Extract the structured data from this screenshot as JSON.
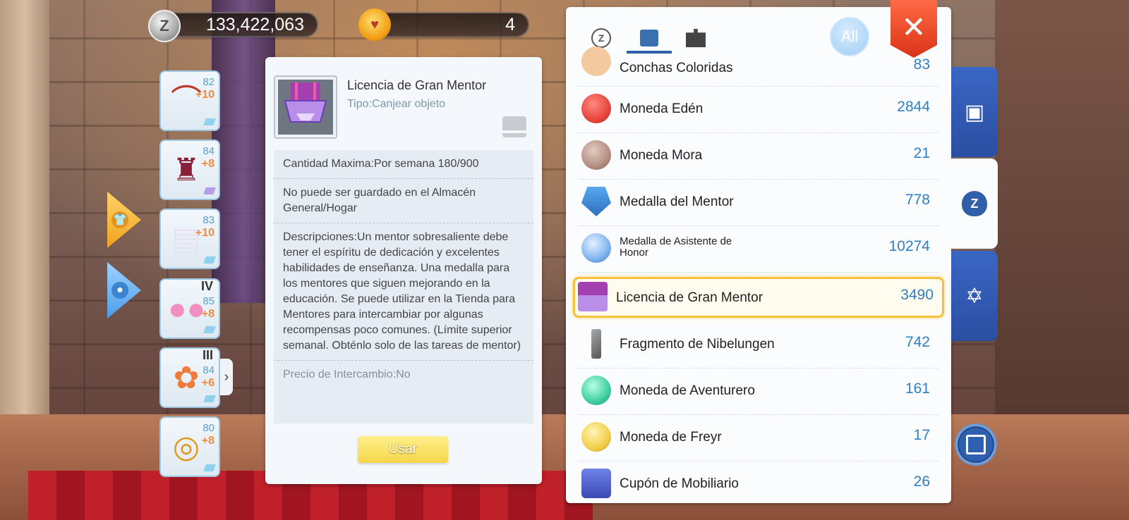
{
  "currency": {
    "zeny": "133,422,063",
    "gems": "4"
  },
  "equipment": [
    {
      "level": "82",
      "refine": "+10",
      "icon": "bracelet-icon",
      "gem": "blue"
    },
    {
      "level": "84",
      "refine": "+8",
      "icon": "armor-icon",
      "gem": "purple"
    },
    {
      "level": "83",
      "refine": "+10",
      "icon": "cloak-icon",
      "gem": "blue"
    },
    {
      "level": "85",
      "refine": "+8",
      "tier": "IV",
      "icon": "slippers-icon",
      "gem": "blue"
    },
    {
      "level": "84",
      "refine": "+6",
      "tier": "III",
      "icon": "fairy-icon",
      "gem": "blue"
    },
    {
      "level": "80",
      "refine": "+8",
      "icon": "ring-icon",
      "gem": "blue"
    }
  ],
  "detail": {
    "title": "Licencia de Gran Mentor",
    "type": "Tipo:Canjear objeto",
    "max_qty": "Cantidad Maxima:Por semana 180/900",
    "storage_note": "No puede ser guardado en el Almacén General/Hogar",
    "description": "Descripciones:Un mentor sobresaliente debe tener el espíritu de dedicación y excelentes habilidades de enseñanza. Una medalla para los mentores que siguen mejorando en la educación. Se puede utilizar en la Tienda para Mentores para intercambiar por algunas recompensas poco comunes. (Límite superior semanal. Obténlo solo de las tareas de mentor)",
    "trade_price": "Precio de Intercambio:No",
    "use_button": "Usar"
  },
  "list": {
    "all_button": "All",
    "close_glyph": "✕",
    "items": [
      {
        "name": "Conchas Coloridas",
        "count": "83",
        "color": "#f3c9a0"
      },
      {
        "name": "Moneda Edén",
        "count": "2844",
        "color": "#e8453c"
      },
      {
        "name": "Moneda Mora",
        "count": "21",
        "color": "#b68f82"
      },
      {
        "name": "Medalla del Mentor",
        "count": "778",
        "color": "#3d8fd8"
      },
      {
        "name": "Medalla de Asistente de Honor",
        "count": "10274",
        "color": "#7fb3ee"
      },
      {
        "name": "Licencia de Gran Mentor",
        "count": "3490",
        "color": "#8a4fd0"
      },
      {
        "name": "Fragmento de Nibelungen",
        "count": "742",
        "color": "#8a8a8a"
      },
      {
        "name": "Moneda de Aventurero",
        "count": "161",
        "color": "#3fcf9f"
      },
      {
        "name": "Moneda de Freyr",
        "count": "17",
        "color": "#f2cf4a"
      },
      {
        "name": "Cupón de Mobiliario",
        "count": "26",
        "color": "#4a5ec7"
      }
    ]
  },
  "colors": {
    "accent": "#2f7fc2",
    "highlight": "#f6c13a",
    "close": "#e2401f"
  }
}
